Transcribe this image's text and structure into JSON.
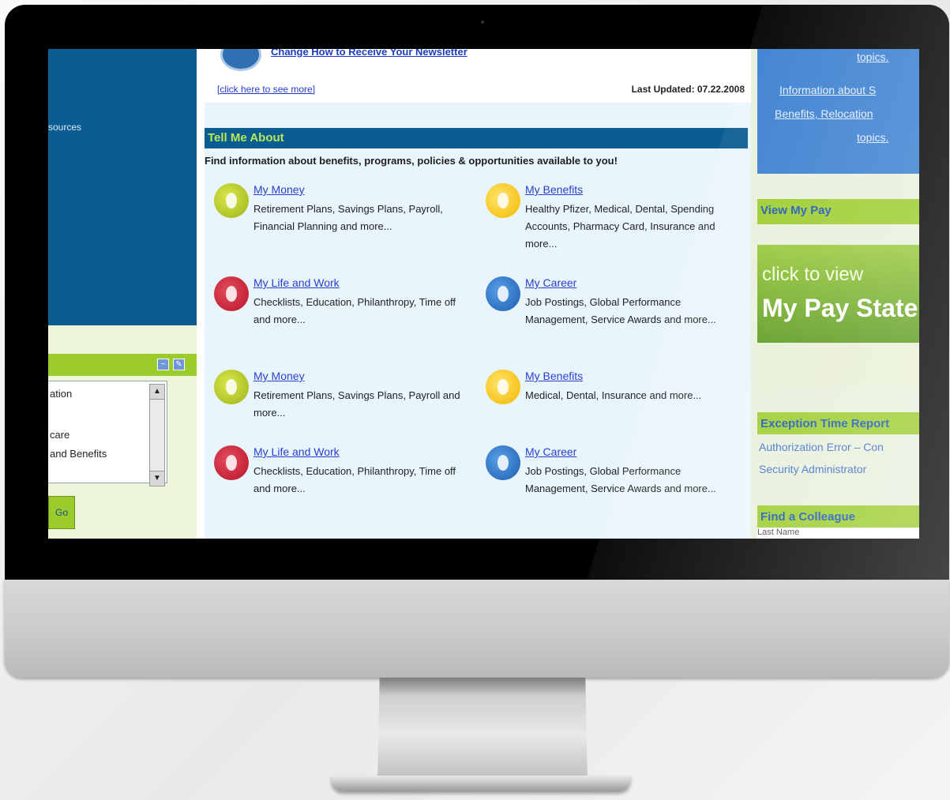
{
  "left": {
    "fragments": [
      "sources",
      "ation",
      "care",
      "and Benefits"
    ],
    "go_label": "Go"
  },
  "center": {
    "newsletter_link": "Change How to Receive Your Newsletter",
    "see_more": "[click here to see more]",
    "last_updated": "Last Updated: 07.22.2008",
    "tell_title": "Tell Me About",
    "tell_subtitle": "Find information about benefits, programs, policies & opportunities available to you!",
    "items": [
      {
        "title": "My Money",
        "desc": "Retirement Plans, Savings Plans, Payroll, Financial Planning and more..."
      },
      {
        "title": "My Benefits",
        "desc": "Healthy Pfizer, Medical, Dental, Spending Accounts, Pharmacy Card, Insurance and more..."
      },
      {
        "title": "My Life and Work",
        "desc": "Checklists, Education, Philanthropy, Time off and more..."
      },
      {
        "title": "My Career",
        "desc": "Job Postings, Global Performance Management, Service Awards and more..."
      },
      {
        "title": "My Money",
        "desc": "Retirement Plans, Savings Plans, Payroll and more..."
      },
      {
        "title": "My Benefits",
        "desc": "Medical, Dental, Insurance and more..."
      },
      {
        "title": "My Life and Work",
        "desc": "Checklists, Education, Philanthropy, Time off and more..."
      },
      {
        "title": "My Career",
        "desc": "Job Postings, Global Performance Management, Service Awards and more..."
      }
    ]
  },
  "right": {
    "blue_lines": [
      "topics.",
      "Information about S",
      "Benefits, Relocation",
      "topics."
    ],
    "view_pay_title": "View My Pay",
    "pay_line1": "click to view",
    "pay_line2": "My Pay State",
    "exception_title": "Exception Time Report",
    "exception_line1": "Authorization Error – Con",
    "exception_line2": "Security Administrator",
    "colleague_title": "Find a Colleague",
    "colleague_field": "Last Name"
  },
  "icons": {
    "money": "money-icon",
    "benefits": "benefits-icon",
    "life": "life-and-work-icon",
    "career": "career-icon"
  },
  "colors": {
    "brand_blue": "#0b5d91",
    "accent_green": "#9ccc2c",
    "link_blue": "#2b3fd0"
  }
}
